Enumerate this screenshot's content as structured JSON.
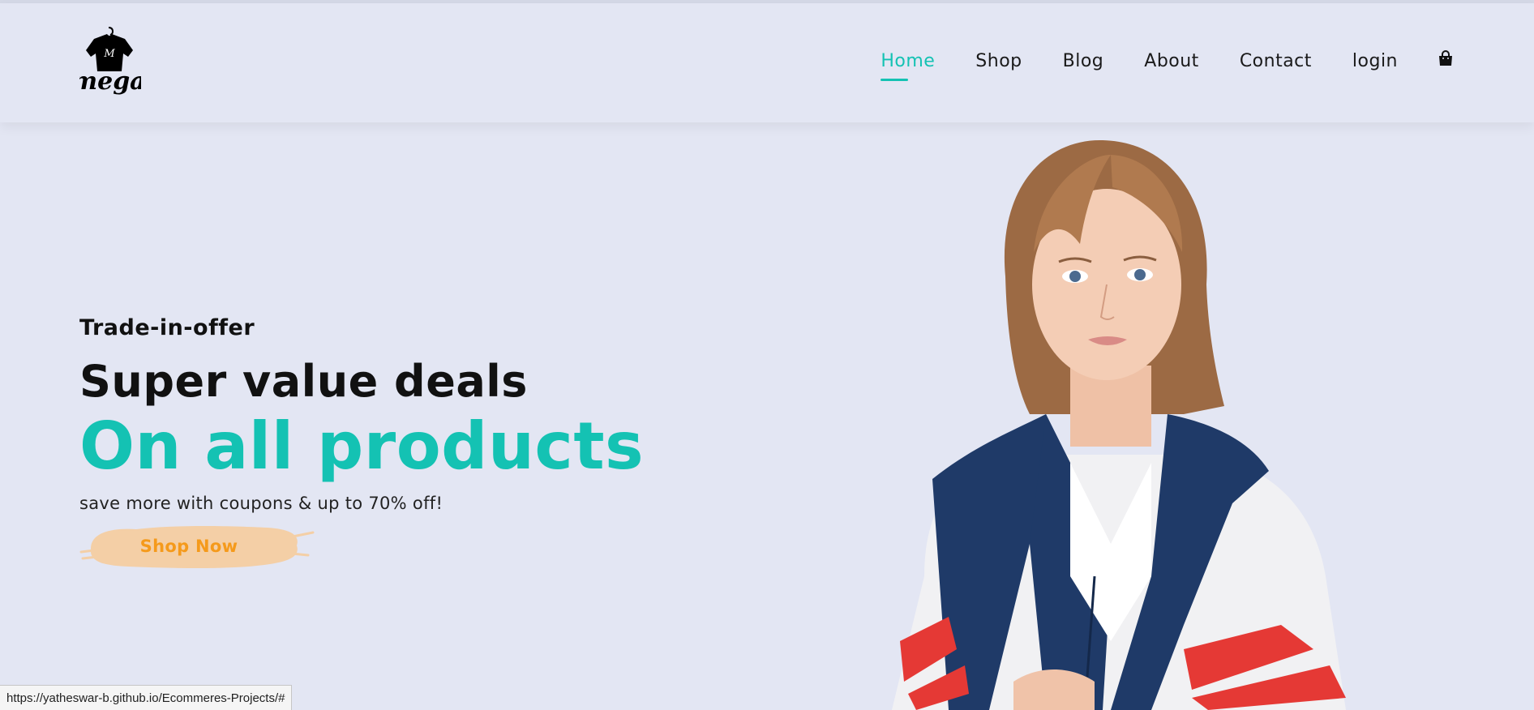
{
  "brand": {
    "name": "mega",
    "badge": "M"
  },
  "nav": {
    "items": [
      {
        "label": "Home",
        "active": true
      },
      {
        "label": "Shop",
        "active": false
      },
      {
        "label": "Blog",
        "active": false
      },
      {
        "label": "About",
        "active": false
      },
      {
        "label": "Contact",
        "active": false
      },
      {
        "label": "login",
        "active": false
      }
    ],
    "cart_icon": "shopping-bag-icon"
  },
  "hero": {
    "eyebrow": "Trade-in-offer",
    "headline": "Super value deals",
    "highlight": "On all products",
    "subtext": "save more with coupons & up to 70% off!",
    "cta_label": "Shop Now"
  },
  "status_bar": {
    "url": "https://yatheswar-b.github.io/Ecommeres-Projects/#"
  },
  "colors": {
    "background": "#e3e6f3",
    "accent": "#14c2b3",
    "cta_text": "#f59a1b",
    "cta_brush": "#f4cfa6",
    "text": "#111111"
  }
}
